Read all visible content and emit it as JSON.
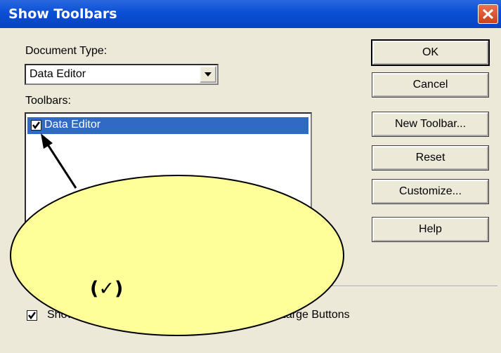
{
  "dialog": {
    "title": "Show Toolbars",
    "close_icon": "close-icon"
  },
  "document_type": {
    "label": "Document Type:",
    "selected": "Data Editor"
  },
  "toolbars": {
    "label": "Toolbars:",
    "items": [
      {
        "label": "Data Editor",
        "checked": true,
        "selected": true
      }
    ]
  },
  "buttons": {
    "ok": "OK",
    "cancel": "Cancel",
    "new_toolbar": "New Toolbar...",
    "reset": "Reset",
    "customize": "Customize...",
    "help": "Help"
  },
  "options": {
    "show_prefix": "Show",
    "large_buttons": "Large Buttons",
    "checked": true
  },
  "annotation": {
    "callout_text": "(✓)",
    "callout_color": "#ffff99"
  },
  "colors": {
    "title_bar": "#0a4fd6",
    "dialog_bg": "#ece9d8",
    "selection": "#316ac5"
  }
}
